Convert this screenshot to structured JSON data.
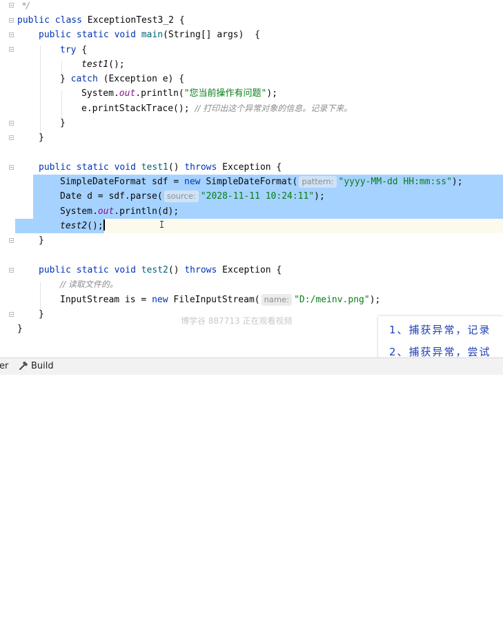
{
  "editor": {
    "lines": {
      "l0": "*/",
      "l1_public": "public",
      "l1_class": "class",
      "l1_rest": " ExceptionTest3_2 {",
      "l2_public": "public",
      "l2_static": "static",
      "l2_void": "void",
      "l2_main": "main",
      "l2_rest": "(String[] args)  {",
      "l3_try": "try",
      "l3_rest": " {",
      "l4_call": "test1",
      "l4_rest": "();",
      "l5_pre": "} ",
      "l5_catch": "catch",
      "l5_rest": " (Exception e) {",
      "l6_a": "System.",
      "l6_out": "out",
      "l6_b": ".println(",
      "l6_str": "\"您当前操作有问题\"",
      "l6_c": ");",
      "l7_code": "e.printStackTrace(); ",
      "l7_comment": "// 打印出这个异常对象的信息。记录下来。",
      "l8": "}",
      "l9": "}",
      "l11_public": "public",
      "l11_static": "static",
      "l11_void": "void",
      "l11_name": "test1",
      "l11_mid": "() ",
      "l11_throws": "throws",
      "l11_rest": " Exception {",
      "l12_a": "SimpleDateFormat sdf = ",
      "l12_new": "new",
      "l12_b": " SimpleDateFormat(",
      "l12_hint": "pattern:",
      "l12_str": "\"yyyy-MM-dd HH:mm:ss\"",
      "l12_c": ");",
      "l13_a": "Date d = sdf.parse(",
      "l13_hint": "source:",
      "l13_str": "\"2028-11-11 10:24:11\"",
      "l13_c": ");",
      "l14_a": "System.",
      "l14_out": "out",
      "l14_b": ".println(d);",
      "l15_call": "test2",
      "l15_rest": "();",
      "l16": "}",
      "l18_public": "public",
      "l18_static": "static",
      "l18_void": "void",
      "l18_name": "test2",
      "l18_mid": "() ",
      "l18_throws": "throws",
      "l18_rest": " Exception {",
      "l19_comment": "// 读取文件的。",
      "l20_a": "InputStream is = ",
      "l20_new": "new",
      "l20_b": " FileInputStream(",
      "l20_hint": "name:",
      "l20_str": "\"D:/meinv.png\"",
      "l20_c": ");",
      "l21": "}",
      "l22": "}"
    },
    "watermark": "博学谷 887713 正在观看视频"
  },
  "notes": {
    "item1": "1、捕获异常，记录",
    "item2": "2、捕获异常，尝试"
  },
  "statusbar": {
    "left_fragment": "er",
    "build_label": "Build"
  },
  "colors": {
    "keyword": "#0033b3",
    "string": "#067d17",
    "selection": "#a6d2ff",
    "comment": "#8c8c8c",
    "note_text": "#1f3fb5"
  }
}
